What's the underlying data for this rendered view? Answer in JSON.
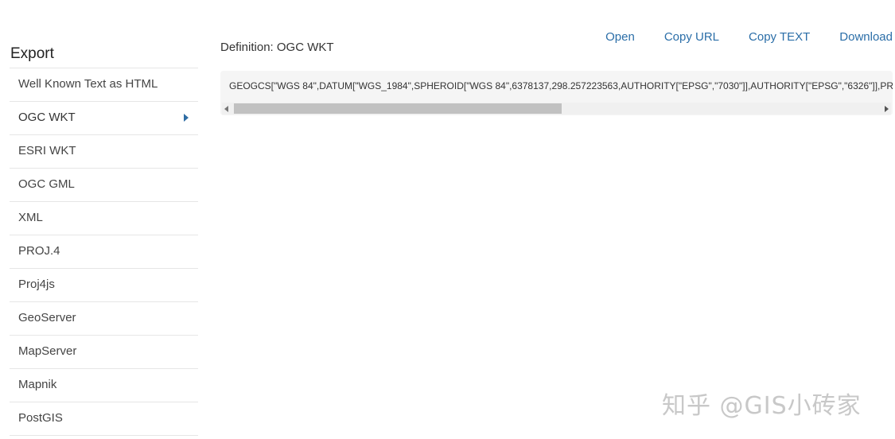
{
  "sidebar": {
    "title": "Export",
    "items": [
      {
        "label": "Well Known Text as HTML"
      },
      {
        "label": "OGC WKT"
      },
      {
        "label": "ESRI WKT"
      },
      {
        "label": "OGC GML"
      },
      {
        "label": "XML"
      },
      {
        "label": "PROJ.4"
      },
      {
        "label": "Proj4js"
      },
      {
        "label": "GeoServer"
      },
      {
        "label": "MapServer"
      },
      {
        "label": "Mapnik"
      },
      {
        "label": "PostGIS"
      }
    ],
    "active_index": 1
  },
  "main": {
    "definition_label": "Definition: OGC WKT",
    "actions": {
      "open": "Open",
      "copy_url": "Copy URL",
      "copy_text": "Copy TEXT",
      "download": "Download"
    },
    "code": "GEOGCS[\"WGS 84\",DATUM[\"WGS_1984\",SPHEROID[\"WGS 84\",6378137,298.257223563,AUTHORITY[\"EPSG\",\"7030\"]],AUTHORITY[\"EPSG\",\"6326\"]],PRI"
  },
  "watermark": "知乎 @GIS小砖家",
  "colors": {
    "link": "#2b6ea8",
    "caret": "#2e6da4",
    "code_bg": "#f5f5f5"
  }
}
